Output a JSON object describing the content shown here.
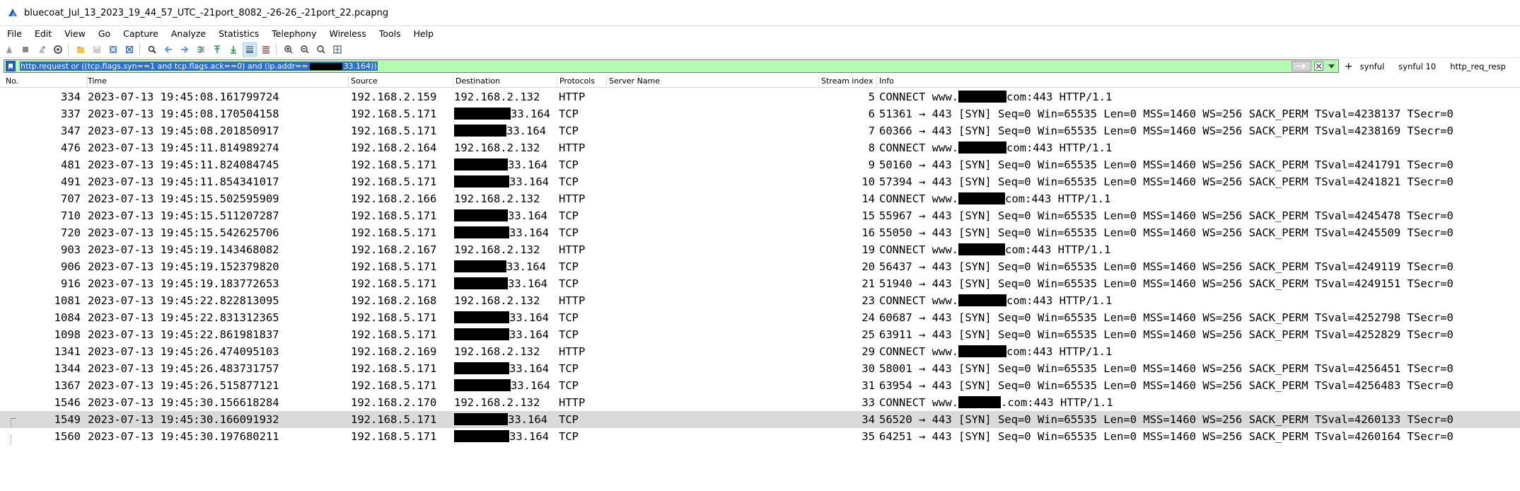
{
  "window": {
    "title": "bluecoat_Jul_13_2023_19_44_57_UTC_-21port_8082_-26-26_-21port_22.pcapng"
  },
  "menu": [
    "File",
    "Edit",
    "View",
    "Go",
    "Capture",
    "Analyze",
    "Statistics",
    "Telephony",
    "Wireless",
    "Tools",
    "Help"
  ],
  "filter": {
    "text_before": "http.request or ((tcp.flags.syn==1 and tcp.flags.ack==0) and (ip.addr==",
    "text_after": "33.164))",
    "buttons": [
      "synful",
      "synful 10",
      "http_req_resp"
    ],
    "plus": "+"
  },
  "columns": [
    "No.",
    "Time",
    "Source",
    "Destination",
    "Protocols",
    "Server Name",
    "Stream index",
    "Info"
  ],
  "packets": [
    {
      "no": "334",
      "time": "2023-07-13 19:45:08.161799724",
      "src": "192.168.2.159",
      "dst": "192.168.2.132",
      "dst_redacted": false,
      "proto": "HTTP",
      "stream": "5",
      "info_a": "CONNECT www.",
      "info_b": "com:443 HTTP/1.1",
      "info_redacted": true
    },
    {
      "no": "337",
      "time": "2023-07-13 19:45:08.170504158",
      "src": "192.168.5.171",
      "dst": "33.164",
      "dst_redacted": true,
      "proto": "TCP",
      "stream": "6",
      "info_a": "51361 → 443 [SYN] Seq=0 Win=65535 Len=0 MSS=1460 WS=256 SACK_PERM TSval=4238137 TSecr=0",
      "info_b": "",
      "info_redacted": false
    },
    {
      "no": "347",
      "time": "2023-07-13 19:45:08.201850917",
      "src": "192.168.5.171",
      "dst": "33.164",
      "dst_redacted": true,
      "proto": "TCP",
      "stream": "7",
      "info_a": "60366 → 443 [SYN] Seq=0 Win=65535 Len=0 MSS=1460 WS=256 SACK_PERM TSval=4238169 TSecr=0",
      "info_b": "",
      "info_redacted": false
    },
    {
      "no": "476",
      "time": "2023-07-13 19:45:11.814989274",
      "src": "192.168.2.164",
      "dst": "192.168.2.132",
      "dst_redacted": false,
      "proto": "HTTP",
      "stream": "8",
      "info_a": "CONNECT www.",
      "info_b": "com:443 HTTP/1.1",
      "info_redacted": true
    },
    {
      "no": "481",
      "time": "2023-07-13 19:45:11.824084745",
      "src": "192.168.5.171",
      "dst": "33.164",
      "dst_redacted": true,
      "proto": "TCP",
      "stream": "9",
      "info_a": "50160 → 443 [SYN] Seq=0 Win=65535 Len=0 MSS=1460 WS=256 SACK_PERM TSval=4241791 TSecr=0",
      "info_b": "",
      "info_redacted": false
    },
    {
      "no": "491",
      "time": "2023-07-13 19:45:11.854341017",
      "src": "192.168.5.171",
      "dst": "33.164",
      "dst_redacted": true,
      "proto": "TCP",
      "stream": "10",
      "info_a": "57394 → 443 [SYN] Seq=0 Win=65535 Len=0 MSS=1460 WS=256 SACK_PERM TSval=4241821 TSecr=0",
      "info_b": "",
      "info_redacted": false
    },
    {
      "no": "707",
      "time": "2023-07-13 19:45:15.502595909",
      "src": "192.168.2.166",
      "dst": "192.168.2.132",
      "dst_redacted": false,
      "proto": "HTTP",
      "stream": "14",
      "info_a": "CONNECT www.",
      "info_b": "com:443 HTTP/1.1",
      "info_redacted": true
    },
    {
      "no": "710",
      "time": "2023-07-13 19:45:15.511207287",
      "src": "192.168.5.171",
      "dst": "33.164",
      "dst_redacted": true,
      "proto": "TCP",
      "stream": "15",
      "info_a": "55967 → 443 [SYN] Seq=0 Win=65535 Len=0 MSS=1460 WS=256 SACK_PERM TSval=4245478 TSecr=0",
      "info_b": "",
      "info_redacted": false
    },
    {
      "no": "720",
      "time": "2023-07-13 19:45:15.542625706",
      "src": "192.168.5.171",
      "dst": "33.164",
      "dst_redacted": true,
      "proto": "TCP",
      "stream": "16",
      "info_a": "55050 → 443 [SYN] Seq=0 Win=65535 Len=0 MSS=1460 WS=256 SACK_PERM TSval=4245509 TSecr=0",
      "info_b": "",
      "info_redacted": false
    },
    {
      "no": "903",
      "time": "2023-07-13 19:45:19.143468082",
      "src": "192.168.2.167",
      "dst": "192.168.2.132",
      "dst_redacted": false,
      "proto": "HTTP",
      "stream": "19",
      "info_a": "CONNECT www.",
      "info_b": "com:443 HTTP/1.1",
      "info_redacted": true
    },
    {
      "no": "906",
      "time": "2023-07-13 19:45:19.152379820",
      "src": "192.168.5.171",
      "dst": "33.164",
      "dst_redacted": true,
      "proto": "TCP",
      "stream": "20",
      "info_a": "56437 → 443 [SYN] Seq=0 Win=65535 Len=0 MSS=1460 WS=256 SACK_PERM TSval=4249119 TSecr=0",
      "info_b": "",
      "info_redacted": false
    },
    {
      "no": "916",
      "time": "2023-07-13 19:45:19.183772653",
      "src": "192.168.5.171",
      "dst": "33.164",
      "dst_redacted": true,
      "proto": "TCP",
      "stream": "21",
      "info_a": "51940 → 443 [SYN] Seq=0 Win=65535 Len=0 MSS=1460 WS=256 SACK_PERM TSval=4249151 TSecr=0",
      "info_b": "",
      "info_redacted": false
    },
    {
      "no": "1081",
      "time": "2023-07-13 19:45:22.822813095",
      "src": "192.168.2.168",
      "dst": "192.168.2.132",
      "dst_redacted": false,
      "proto": "HTTP",
      "stream": "23",
      "info_a": "CONNECT www.",
      "info_b": "com:443 HTTP/1.1",
      "info_redacted": true
    },
    {
      "no": "1084",
      "time": "2023-07-13 19:45:22.831312365",
      "src": "192.168.5.171",
      "dst": "33.164",
      "dst_redacted": true,
      "proto": "TCP",
      "stream": "24",
      "info_a": "60687 → 443 [SYN] Seq=0 Win=65535 Len=0 MSS=1460 WS=256 SACK_PERM TSval=4252798 TSecr=0",
      "info_b": "",
      "info_redacted": false
    },
    {
      "no": "1098",
      "time": "2023-07-13 19:45:22.861981837",
      "src": "192.168.5.171",
      "dst": "33.164",
      "dst_redacted": true,
      "proto": "TCP",
      "stream": "25",
      "info_a": "63911 → 443 [SYN] Seq=0 Win=65535 Len=0 MSS=1460 WS=256 SACK_PERM TSval=4252829 TSecr=0",
      "info_b": "",
      "info_redacted": false
    },
    {
      "no": "1341",
      "time": "2023-07-13 19:45:26.474095103",
      "src": "192.168.2.169",
      "dst": "192.168.2.132",
      "dst_redacted": false,
      "proto": "HTTP",
      "stream": "29",
      "info_a": "CONNECT www.",
      "info_b": "com:443 HTTP/1.1",
      "info_redacted": true
    },
    {
      "no": "1344",
      "time": "2023-07-13 19:45:26.483731757",
      "src": "192.168.5.171",
      "dst": "33.164",
      "dst_redacted": true,
      "proto": "TCP",
      "stream": "30",
      "info_a": "58001 → 443 [SYN] Seq=0 Win=65535 Len=0 MSS=1460 WS=256 SACK_PERM TSval=4256451 TSecr=0",
      "info_b": "",
      "info_redacted": false
    },
    {
      "no": "1367",
      "time": "2023-07-13 19:45:26.515877121",
      "src": "192.168.5.171",
      "dst": "33.164",
      "dst_redacted": true,
      "proto": "TCP",
      "stream": "31",
      "info_a": "63954 → 443 [SYN] Seq=0 Win=65535 Len=0 MSS=1460 WS=256 SACK_PERM TSval=4256483 TSecr=0",
      "info_b": "",
      "info_redacted": false
    },
    {
      "no": "1546",
      "time": "2023-07-13 19:45:30.156618284",
      "src": "192.168.2.170",
      "dst": "192.168.2.132",
      "dst_redacted": false,
      "proto": "HTTP",
      "stream": "33",
      "info_a": "CONNECT www.",
      "info_b": ".com:443 HTTP/1.1",
      "info_redacted": true
    },
    {
      "no": "1549",
      "time": "2023-07-13 19:45:30.166091932",
      "src": "192.168.5.171",
      "dst": "33.164",
      "dst_redacted": true,
      "proto": "TCP",
      "stream": "34",
      "info_a": "56520 → 443 [SYN] Seq=0 Win=65535 Len=0 MSS=1460 WS=256 SACK_PERM TSval=4260133 TSecr=0",
      "info_b": "",
      "info_redacted": false,
      "selected": true
    },
    {
      "no": "1560",
      "time": "2023-07-13 19:45:30.197680211",
      "src": "192.168.5.171",
      "dst": "33.164",
      "dst_redacted": true,
      "proto": "TCP",
      "stream": "35",
      "info_a": "64251 → 443 [SYN] Seq=0 Win=65535 Len=0 MSS=1460 WS=256 SACK_PERM TSval=4260164 TSecr=0",
      "info_b": "",
      "info_redacted": false
    }
  ],
  "colors": {
    "filter_valid_bg": "#afffaf",
    "selected_row_bg": "#dadada",
    "filter_selection": "#2a6fd6"
  }
}
